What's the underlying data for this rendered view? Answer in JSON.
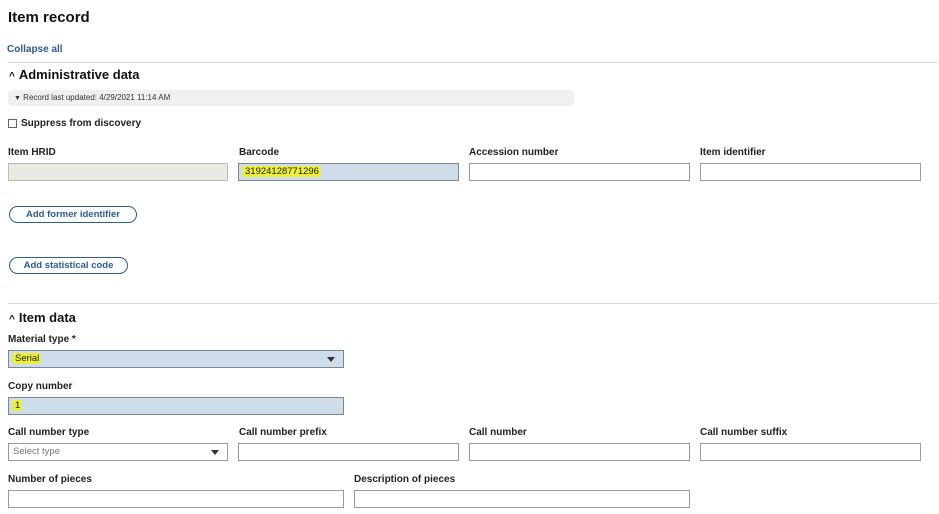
{
  "page": {
    "title": "Item record",
    "collapse_all": "Collapse all"
  },
  "admin": {
    "heading": "Administrative data",
    "record_updated": "Record last updated: 4/29/2021 11:14 AM",
    "suppress_label": "Suppress from discovery",
    "labels": {
      "item_hrid": "Item HRID",
      "barcode": "Barcode",
      "accession": "Accession number",
      "item_identifier": "Item identifier"
    },
    "values": {
      "item_hrid": "",
      "barcode": "31924128771296",
      "accession": "",
      "item_identifier": ""
    },
    "add_former_identifier": "Add former identifier",
    "add_statistical_code": "Add statistical code"
  },
  "item": {
    "heading": "Item data",
    "material_type_label": "Material type *",
    "material_type_value": "Serial",
    "copy_number_label": "Copy number",
    "copy_number_value": "1",
    "call_number_type_label": "Call number type",
    "call_number_type_placeholder": "Select type",
    "call_number_prefix_label": "Call number prefix",
    "call_number_label": "Call number",
    "call_number_suffix_label": "Call number suffix",
    "number_of_pieces_label": "Number of pieces",
    "description_of_pieces_label": "Description of pieces"
  },
  "colors": {
    "link": "#2b5e91",
    "highlight": "#eef035",
    "filled_field": "#cfdce9"
  }
}
